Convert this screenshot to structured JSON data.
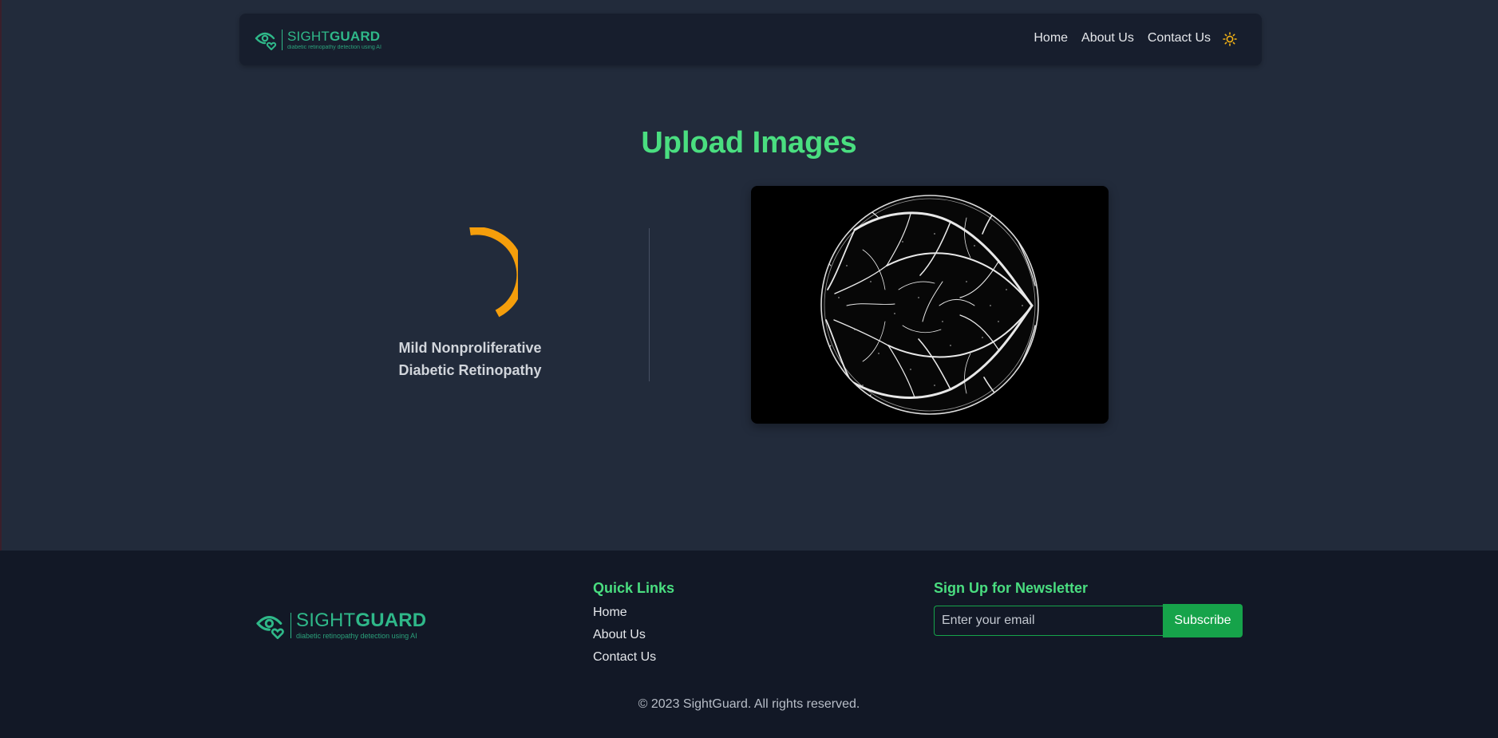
{
  "brand": {
    "name_light": "SIGHT",
    "name_bold": "GUARD",
    "tagline": "diabetic retinopathy detection using AI",
    "color": "#2fb889"
  },
  "nav": {
    "links": [
      {
        "label": "Home"
      },
      {
        "label": "About Us"
      },
      {
        "label": "Contact Us"
      }
    ],
    "theme_toggle_icon": "sun-icon"
  },
  "main": {
    "title": "Upload Images",
    "result": {
      "label_line1": "Mild Nonproliferative",
      "label_line2": "Diabetic Retinopathy",
      "indicator_color": "#f59e0b"
    },
    "image_description_icon": "retina-vessel-image"
  },
  "footer": {
    "quick_links": {
      "title": "Quick Links",
      "items": [
        {
          "label": "Home"
        },
        {
          "label": "About Us"
        },
        {
          "label": "Contact Us"
        }
      ]
    },
    "newsletter": {
      "title": "Sign Up for Newsletter",
      "input_placeholder": "Enter your email",
      "input_value": "",
      "button_label": "Subscribe"
    },
    "copyright": "© 2023 SightGuard. All rights reserved."
  },
  "colors": {
    "accent": "#4ade80",
    "button": "#16a34a",
    "background": "#222b3b",
    "navbar": "#171e2d",
    "footer": "#121826"
  }
}
